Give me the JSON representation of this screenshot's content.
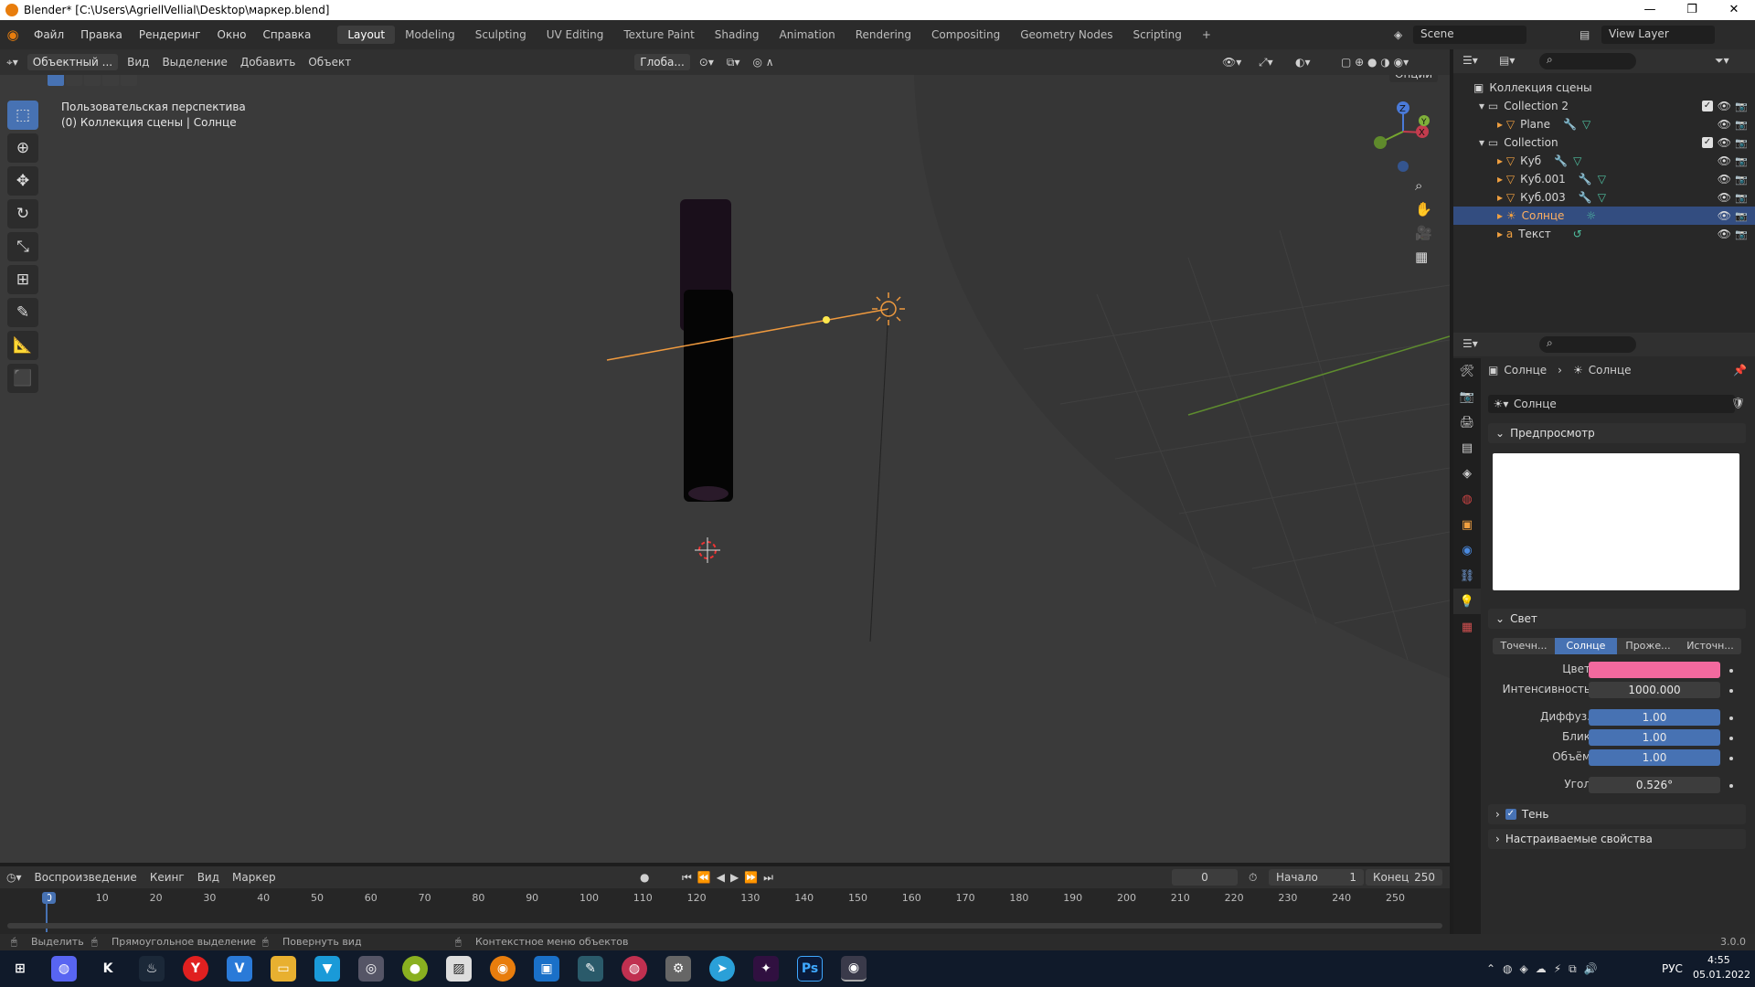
{
  "titlebar": {
    "title": "Blender* [C:\\Users\\AgriellVellial\\Desktop\\маркер.blend]"
  },
  "menu": {
    "items": [
      "Файл",
      "Правка",
      "Рендеринг",
      "Окно",
      "Справка"
    ]
  },
  "workspaces": [
    "Layout",
    "Modeling",
    "Sculpting",
    "UV Editing",
    "Texture Paint",
    "Shading",
    "Animation",
    "Rendering",
    "Compositing",
    "Geometry Nodes",
    "Scripting"
  ],
  "scene": {
    "name": "Scene",
    "view_layer": "View Layer"
  },
  "viewport_header": {
    "mode": "Объектный ...",
    "view": "Вид",
    "select": "Выделение",
    "add": "Добавить",
    "object": "Объект",
    "orientation": "Глоба...",
    "options": "Опции"
  },
  "viewport": {
    "perspective": "Пользовательская перспектива",
    "info": "(0) Коллекция сцены | Солнце"
  },
  "outliner": {
    "root": "Коллекция сцены",
    "items": [
      {
        "name": "Collection 2"
      },
      {
        "name": "Plane"
      },
      {
        "name": "Collection"
      },
      {
        "name": "Куб"
      },
      {
        "name": "Куб.001"
      },
      {
        "name": "Куб.003"
      },
      {
        "name": "Солнце"
      },
      {
        "name": "Текст"
      }
    ]
  },
  "properties": {
    "breadcrumb_obj": "Солнце",
    "breadcrumb_data": "Солнце",
    "datablock": "Солнце",
    "preview_panel": "Предпросмотр",
    "light_panel": "Свет",
    "light_types": [
      "Точечн...",
      "Солнце",
      "Проже...",
      "Источн..."
    ],
    "color_label": "Цвет",
    "color_value": "#f2699e",
    "strength_label": "Интенсивность",
    "strength": "1000.000",
    "diffuse_label": "Диффуз.",
    "diffuse": "1.00",
    "specular_label": "Блик",
    "specular": "1.00",
    "volume_label": "Объём",
    "volume": "1.00",
    "angle_label": "Угол",
    "angle": "0.526°",
    "shadow_panel": "Тень",
    "custom_panel": "Настраиваемые свойства"
  },
  "timeline": {
    "playback": "Воспроизведение",
    "keying": "Кеинг",
    "view": "Вид",
    "marker": "Маркер",
    "current_frame": "0",
    "start_label": "Начало",
    "start": "1",
    "end_label": "Конец",
    "end": "250",
    "ticks": [
      "0",
      "10",
      "20",
      "30",
      "40",
      "50",
      "60",
      "70",
      "80",
      "90",
      "100",
      "110",
      "120",
      "130",
      "140",
      "150",
      "160",
      "170",
      "180",
      "190",
      "200",
      "210",
      "220",
      "230",
      "240",
      "250"
    ]
  },
  "status": {
    "select": "Выделить",
    "box_select": "Прямоугольное выделение",
    "rotate_view": "Повернуть вид",
    "context_menu": "Контекстное меню объектов",
    "version": "3.0.0"
  },
  "taskbar": {
    "lang": "РУС",
    "time": "4:55",
    "date": "05.01.2022"
  }
}
